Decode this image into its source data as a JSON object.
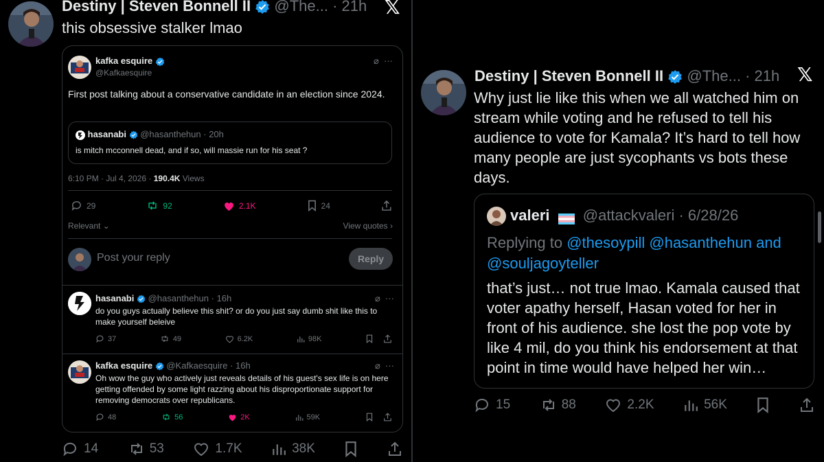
{
  "left": {
    "author_name": "Destiny | Steven Bonnell II",
    "author_handle": "@The...",
    "time": "21h",
    "text": "this obsessive stalker lmao",
    "quoted": {
      "author_name": "kafka esquire",
      "author_handle": "@Kafkaesquire",
      "text": "First post talking about a conservative candidate in an election since 2024.",
      "inner_quote": {
        "author_name": "hasanabi",
        "author_handle": "@hasanthehun",
        "time": "20h",
        "text": "is mitch mcconnell dead, and if so, will massie run for his seat ?"
      },
      "timestamp": "6:10 PM · Jul 4, 2026 · ",
      "views_count": "190.4K",
      "views_label": " Views",
      "stats": {
        "replies": "29",
        "reposts": "92",
        "likes": "2.1K",
        "bookmarks": "24"
      },
      "sort_label": "Relevant",
      "view_quotes_label": "View quotes",
      "reply_placeholder": "Post your reply",
      "reply_button": "Reply",
      "replies": [
        {
          "author_name": "hasanabi",
          "author_handle": "@hasanthehun",
          "time": "16h",
          "text": "do you guys actually believe this shit? or do you just say dumb shit like this to make yourself beleive",
          "replies": "37",
          "reposts": "49",
          "likes": "6.2K",
          "views": "98K"
        },
        {
          "author_name": "kafka esquire",
          "author_handle": "@Kafkaesquire",
          "time": "16h",
          "text": "Oh wow the guy who actively just reveals details of his guest's sex life is on here getting offended by some light razzing about his disproportionate support for removing democrats over republicans.",
          "replies": "48",
          "reposts": "56",
          "likes": "2K",
          "views": "59K"
        }
      ]
    },
    "stats": {
      "replies": "14",
      "reposts": "53",
      "likes": "1.7K",
      "views": "38K"
    }
  },
  "right": {
    "author_name": "Destiny | Steven Bonnell II",
    "author_handle": "@The...",
    "time": "21h",
    "text": "Why just lie like this when we all watched him on stream while voting and he refused to tell his audience to vote for Kamala? It’s hard to tell how many people are just sycophants vs bots these days.",
    "quoted": {
      "author_name": "valeri",
      "author_handle": "@attackvaleri",
      "time": "6/28/26",
      "replying_prefix": "Replying to ",
      "mentions": [
        "@thesoypill",
        "@hasanthehun",
        "and",
        "@souljagoyteller"
      ],
      "text": "that’s just… not true lmao. Kamala caused that voter apathy herself, Hasan voted for her in front of his audience. she lost the pop vote by like 4 mil, do you think his endorsement at that point in time would have helped her win…"
    },
    "stats": {
      "replies": "15",
      "reposts": "88",
      "likes": "2.2K",
      "views": "56K"
    }
  },
  "colors": {
    "background": "#000000",
    "text": "#e7e9ea",
    "muted": "#71767b",
    "accent": "#1d9bf0",
    "repost_green": "#00ba7c",
    "like_pink": "#f91880",
    "border": "#2f3336"
  },
  "icons": [
    "x-logo-icon",
    "verified-badge-icon",
    "grok-icon",
    "more-icon",
    "reply-icon",
    "repost-icon",
    "like-icon",
    "views-icon",
    "bookmark-icon",
    "share-icon",
    "chevron-down-icon",
    "chevron-right-icon",
    "flag-icon"
  ]
}
